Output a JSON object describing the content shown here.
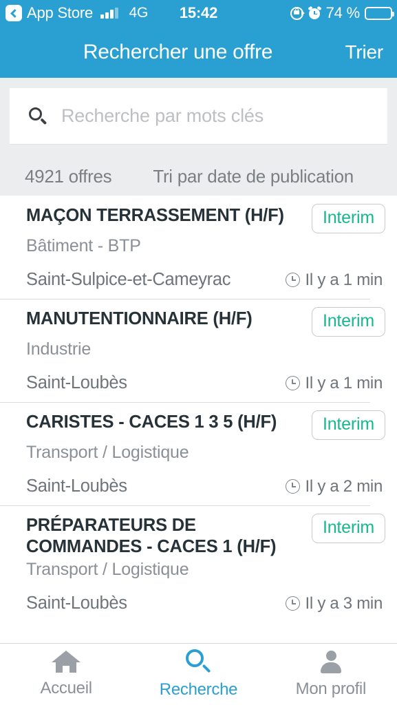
{
  "status_bar": {
    "back_app_label": "App Store",
    "back_icon": "chevron-left-icon",
    "signal_icon": "cellular-signal-icon",
    "network": "4G",
    "time": "15:42",
    "rotation_lock_icon": "rotation-lock-icon",
    "alarm_icon": "alarm-clock-icon",
    "battery_percent": "74 %",
    "battery_icon": "battery-icon",
    "battery_fill_color": "#FFCC00"
  },
  "nav_bar": {
    "title": "Rechercher une offre",
    "action_label": "Trier",
    "background_color": "#2AA0D2"
  },
  "search": {
    "icon": "search-icon",
    "value": "",
    "placeholder": "Recherche par mots clés"
  },
  "results_meta": {
    "count_label": "4921 offres",
    "sort_label": "Tri par date de publication"
  },
  "jobs": [
    {
      "title": "MAÇON TERRASSEMENT (H/F)",
      "badge": "Interim",
      "sector": "Bâtiment - BTP",
      "city": "Saint-Sulpice-et-Cameyrac",
      "time_icon": "clock-icon",
      "time": "Il y a 1 min"
    },
    {
      "title": "MANUTENTIONNAIRE (H/F)",
      "badge": "Interim",
      "sector": "Industrie",
      "city": "Saint-Loubès",
      "time_icon": "clock-icon",
      "time": "Il y a 1 min"
    },
    {
      "title": "CARISTES - CACES 1 3 5 (H/F)",
      "badge": "Interim",
      "sector": "Transport / Logistique",
      "city": "Saint-Loubès",
      "time_icon": "clock-icon",
      "time": "Il y a 2 min"
    },
    {
      "title": "PRÉPARATEURS DE COMMANDES - CACES 1 (H/F)",
      "badge": "Interim",
      "sector": "Transport / Logistique",
      "city": "Saint-Loubès",
      "time_icon": "clock-icon",
      "time": "Il y a 3 min"
    }
  ],
  "tab_bar": {
    "active_color": "#2AA0D2",
    "inactive_color": "#8B9096",
    "items": [
      {
        "label": "Accueil",
        "icon": "home-icon",
        "active": false
      },
      {
        "label": "Recherche",
        "icon": "search-icon",
        "active": true
      },
      {
        "label": "Mon profil",
        "icon": "person-icon",
        "active": false
      }
    ]
  },
  "theme": {
    "accent": "#2AA0D2",
    "badge_text": "#17B890",
    "title_text": "#263238",
    "muted_text": "#8B9096",
    "band_background": "#ECEDEE"
  }
}
